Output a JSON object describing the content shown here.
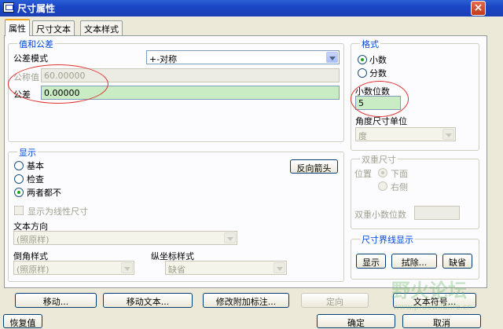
{
  "window": {
    "title": "尺寸属性",
    "close": "×"
  },
  "tabs": [
    "属性",
    "尺寸文本",
    "文本样式"
  ],
  "tolerance": {
    "legend": "值和公差",
    "mode_label": "公差模式",
    "mode_value": "+-对称",
    "nominal_label": "公称值",
    "nominal_value": "60.00000",
    "tolerance_label": "公差",
    "tolerance_value": "0.00000"
  },
  "format": {
    "legend": "格式",
    "decimal": "小数",
    "fraction": "分数",
    "decimal_places_label": "小数位数",
    "decimal_places_value": "5",
    "angle_unit_label": "角度尺寸单位",
    "angle_unit_value": "度"
  },
  "display": {
    "legend": "显示",
    "basic": "基本",
    "check": "检查",
    "both": "两者都不",
    "reverse_arrow": "反向箭头",
    "linear_checkbox": "显示为线性尺寸",
    "text_direction_label": "文本方向",
    "text_direction_value": "(照原样)",
    "chamfer_label": "倒角样式",
    "chamfer_value": "(照原样)",
    "ordinate_label": "纵坐标样式",
    "ordinate_value": "缺省"
  },
  "dual": {
    "legend": "双重尺寸",
    "position_label": "位置",
    "below": "下面",
    "right": "右侧",
    "dual_places_label": "双重小数位数"
  },
  "witness": {
    "legend": "尺寸界线显示",
    "show": "显示",
    "erase": "拭除...",
    "default": "缺省"
  },
  "buttons": {
    "move": "移动...",
    "move_text": "移动文本...",
    "modify_note": "修改附加标注...",
    "orient": "定向",
    "text_symbol": "文本符号..."
  },
  "footer": {
    "restore": "恢复值",
    "ok": "确定",
    "cancel": "取消"
  },
  "watermark": {
    "text": "野火论坛",
    "url": "www.proewildfire.cn"
  }
}
